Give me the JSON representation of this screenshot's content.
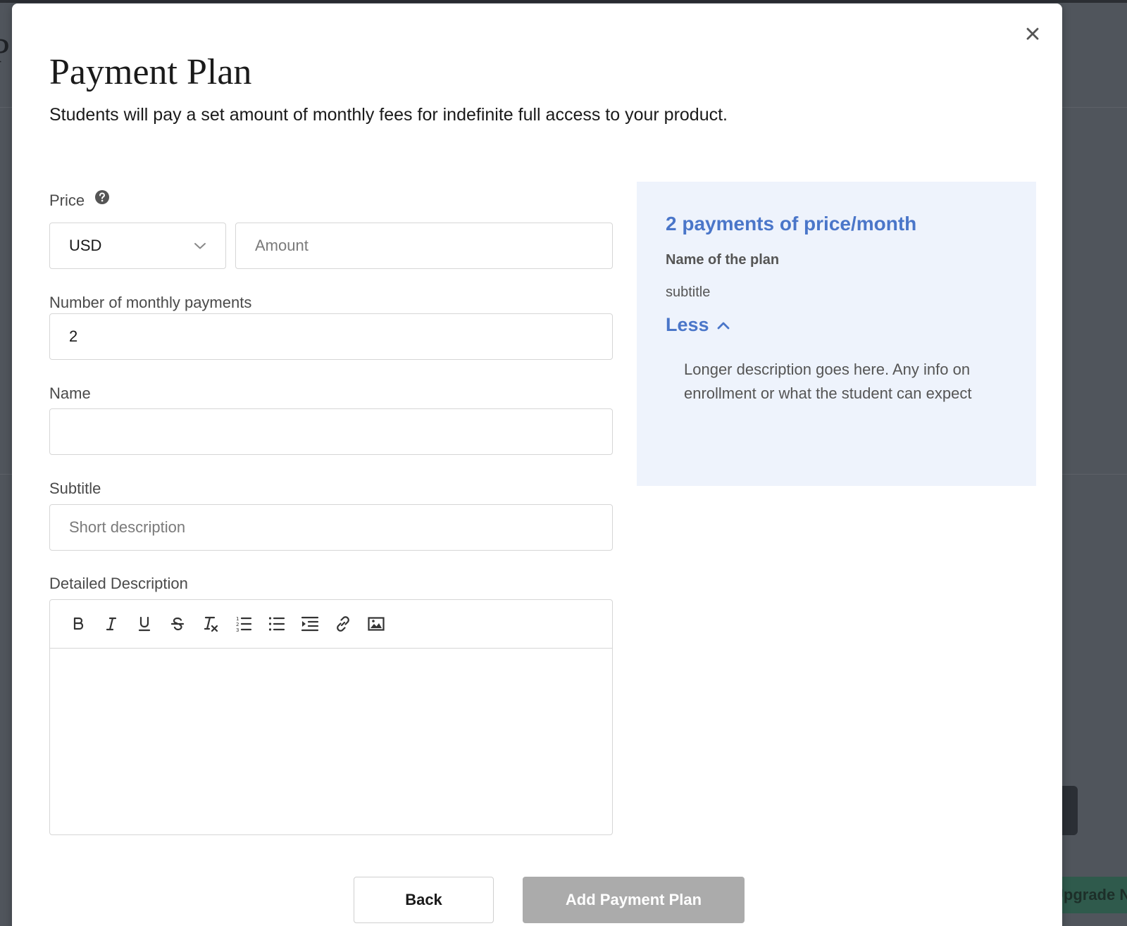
{
  "background": {
    "letter": "P",
    "upgrade_label": "Upgrade Now"
  },
  "modal": {
    "title": "Payment Plan",
    "subtitle": "Students will pay a set amount of monthly fees for indefinite full access to your product."
  },
  "form": {
    "price_label": "Price",
    "currency_value": "USD",
    "amount_placeholder": "Amount",
    "payments_label": "Number of monthly payments",
    "payments_value": "2",
    "name_label": "Name",
    "name_value": "",
    "subtitle_label": "Subtitle",
    "subtitle_placeholder": "Short description",
    "description_label": "Detailed Description"
  },
  "editor_toolbar": [
    "bold-icon",
    "italic-icon",
    "underline-icon",
    "strikethrough-icon",
    "clear-format-icon",
    "ordered-list-icon",
    "bullet-list-icon",
    "indent-icon",
    "link-icon",
    "image-icon"
  ],
  "preview": {
    "heading": "2 payments of price/month",
    "plan_name": "Name of the plan",
    "plan_subtitle": "subtitle",
    "toggle_label": "Less",
    "description": "Longer description goes here. Any info on enrollment or what the student can expect"
  },
  "footer": {
    "back_label": "Back",
    "add_label": "Add Payment Plan"
  },
  "colors": {
    "accent": "#4a76c9",
    "preview_bg": "#eef3fc",
    "disabled_button": "#ababab",
    "overlay": "#50555c"
  }
}
